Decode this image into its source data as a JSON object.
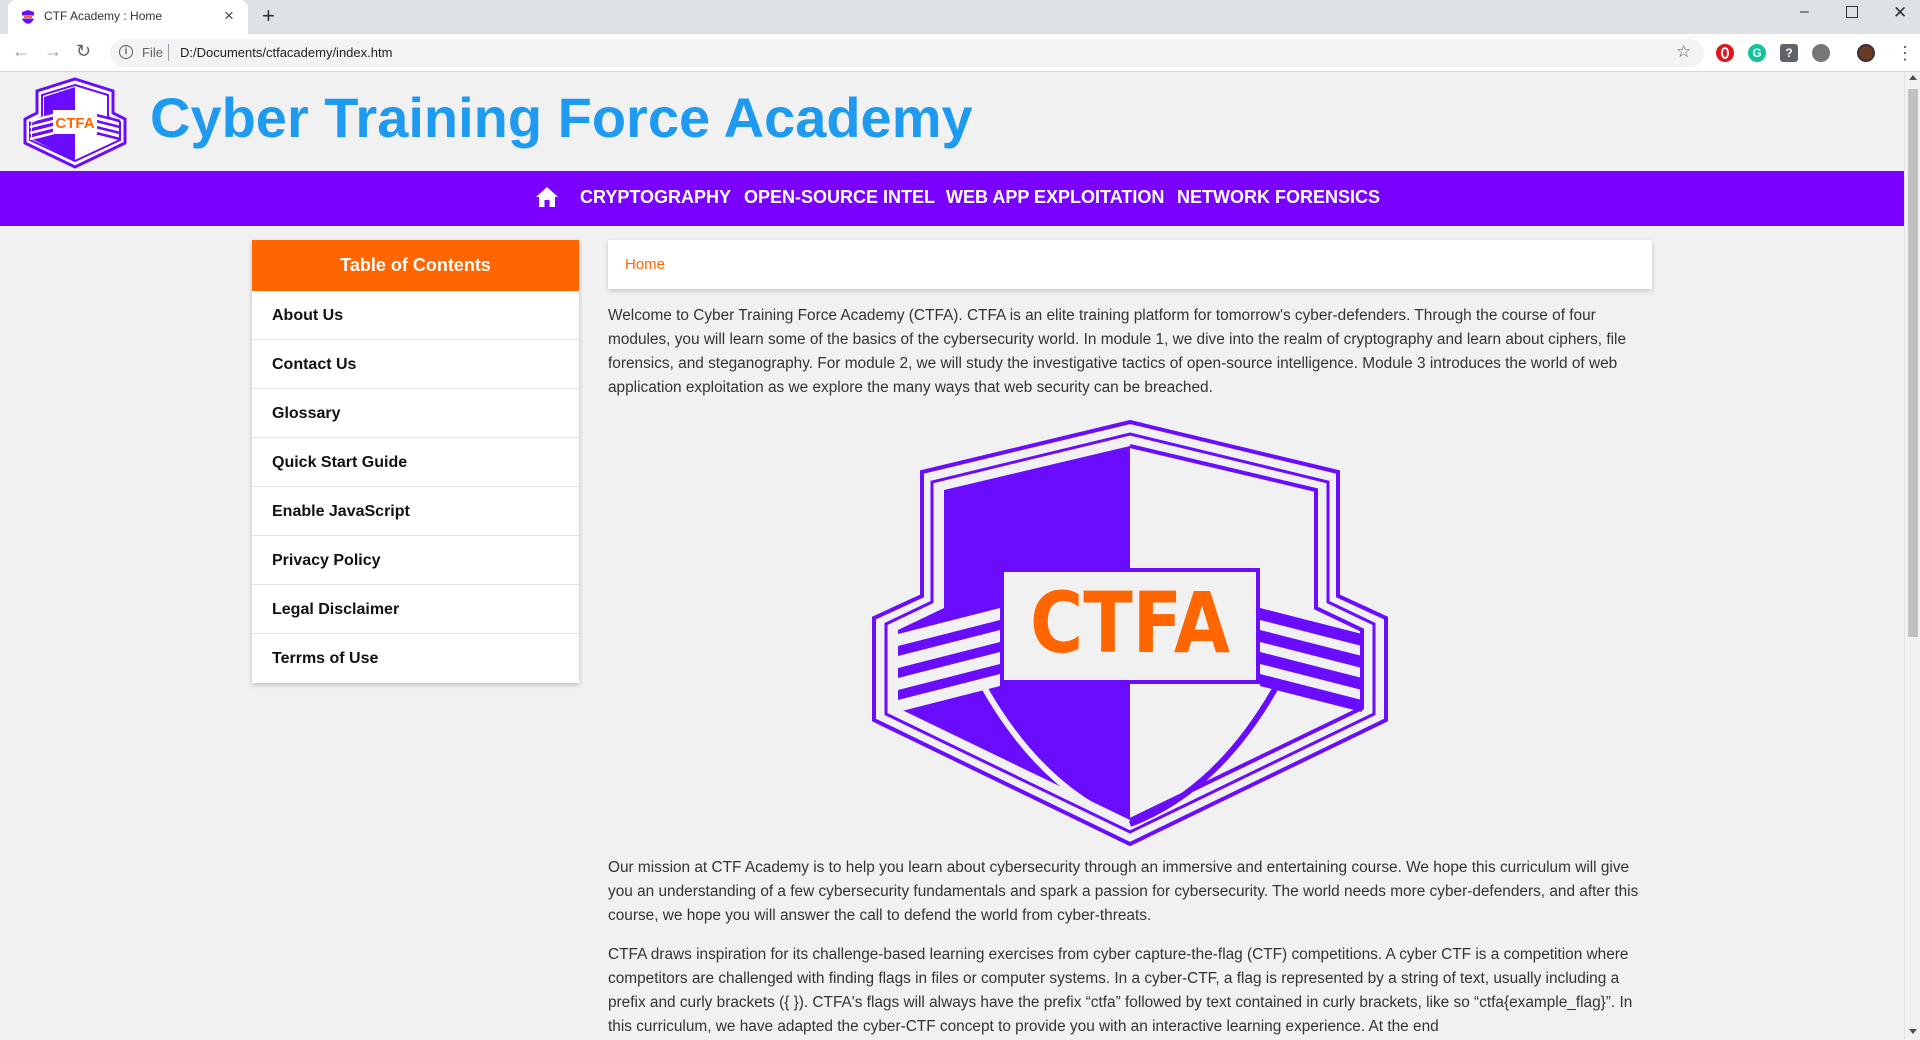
{
  "browser": {
    "tab_title": "CTF Academy : Home",
    "url_scheme": "File",
    "url_path": "D:/Documents/ctfacademy/index.htm",
    "extensions": [
      "opera-icon",
      "grammarly-icon",
      "help-icon",
      "globe-icon",
      "profile-avatar"
    ]
  },
  "site": {
    "title": "Cyber Training Force Academy",
    "logo_text": "CTFA",
    "colors": {
      "title": "#1e9bf0",
      "nav": "#7a00ff",
      "accent": "#ff6600",
      "logo_primary": "#6a0dff"
    }
  },
  "nav": {
    "home_icon": "home-icon",
    "items": [
      {
        "label": "CRYPTOGRAPHY"
      },
      {
        "label": "OPEN-SOURCE INTEL"
      },
      {
        "label": "WEB APP EXPLOITATION"
      },
      {
        "label": "NETWORK FORENSICS"
      }
    ]
  },
  "toc": {
    "title": "Table of Contents",
    "items": [
      {
        "label": "About Us"
      },
      {
        "label": "Contact Us"
      },
      {
        "label": "Glossary"
      },
      {
        "label": "Quick Start Guide"
      },
      {
        "label": "Enable JavaScript"
      },
      {
        "label": "Privacy Policy"
      },
      {
        "label": "Legal Disclaimer"
      },
      {
        "label": "Terrms of Use"
      }
    ]
  },
  "main": {
    "breadcrumb": "Home",
    "paragraphs": [
      "Welcome to Cyber Training Force Academy (CTFA). CTFA is an elite training platform for tomorrow's cyber-defenders. Through the course of four modules, you will learn some of the basics of the cybersecurity world. In module 1, we dive into the realm of cryptography and learn about ciphers, file forensics, and steganography. For module 2, we will study the investigative tactics of open-source intelligence. Module 3 introduces the world of web application exploitation as we explore the many ways that web security can be breached.",
      "Our mission at CTF Academy is to help you learn about cybersecurity through an immersive and entertaining course. We hope this curriculum will give you an understanding of a few cybersecurity fundamentals and spark a passion for cybersecurity. The world needs more cyber-defenders, and after this course, we hope you will answer the call to defend the world from cyber-threats.",
      "CTFA draws inspiration for its challenge-based learning exercises from cyber capture-the-flag (CTF) competitions. A cyber CTF is a competition where competitors are challenged with finding flags in files or computer systems. In a cyber-CTF, a flag is represented by a string of text, usually including a prefix and curly brackets ({ }). CTFA's flags will always have the prefix “ctfa” followed by text contained in curly brackets, like so “ctfa{example_flag}”. In this curriculum, we have adapted the cyber-CTF concept to provide you with an interactive learning experience. At the end"
    ]
  }
}
